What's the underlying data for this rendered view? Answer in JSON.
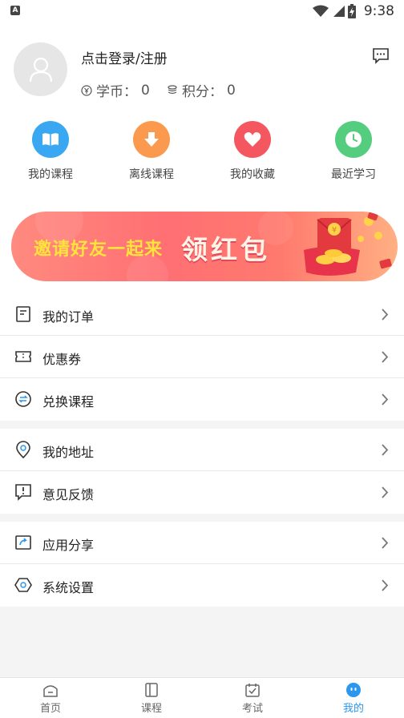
{
  "status_bar": {
    "time": "9:38"
  },
  "profile": {
    "login_text": "点击登录/注册",
    "coin_label": "学币：",
    "coin_value": "0",
    "points_label": "积分：",
    "points_value": "0"
  },
  "quick_links": [
    {
      "label": "我的课程",
      "icon": "book-icon",
      "color": "#39a7f2"
    },
    {
      "label": "离线课程",
      "icon": "download-icon",
      "color": "#fb9a4e"
    },
    {
      "label": "我的收藏",
      "icon": "heart-icon",
      "color": "#f4575f"
    },
    {
      "label": "最近学习",
      "icon": "clock-icon",
      "color": "#55cd7f"
    }
  ],
  "banner": {
    "text_left": "邀请好友一起来",
    "text_right": "领红包"
  },
  "menu": {
    "orders": "我的订单",
    "coupons": "优惠券",
    "redeem": "兑换课程",
    "address": "我的地址",
    "feedback": "意见反馈",
    "share": "应用分享",
    "settings": "系统设置"
  },
  "tabs": [
    {
      "label": "首页",
      "icon": "home-icon",
      "active": false
    },
    {
      "label": "课程",
      "icon": "course-icon",
      "active": false
    },
    {
      "label": "考试",
      "icon": "exam-icon",
      "active": false
    },
    {
      "label": "我的",
      "icon": "me-icon",
      "active": true
    }
  ],
  "colors": {
    "accent": "#2b97ee",
    "background": "#f4f4f4"
  }
}
